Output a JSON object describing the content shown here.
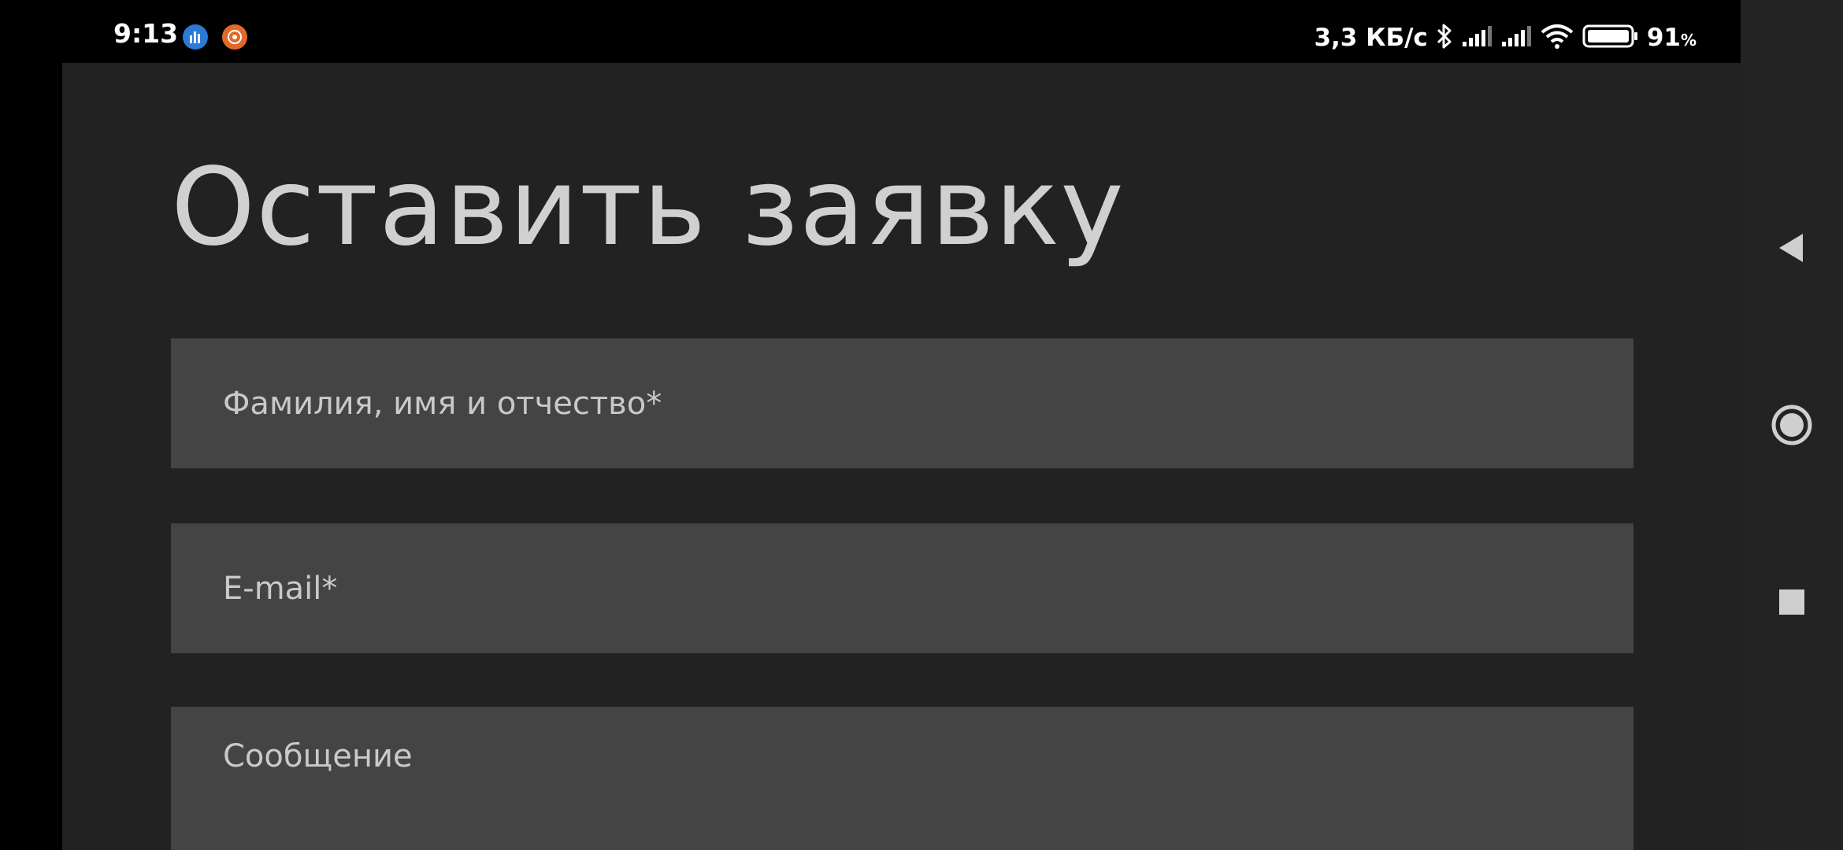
{
  "status_bar": {
    "time": "9:13",
    "net_speed": "3,3 КБ/с",
    "battery_percent": "91",
    "battery_unit": "%",
    "icons": [
      "notification-app-1-icon",
      "notification-app-2-icon",
      "bluetooth-icon",
      "signal-1-icon",
      "signal-2-icon",
      "wifi-icon",
      "battery-icon"
    ]
  },
  "form": {
    "title": "Оставить заявку",
    "name_placeholder": "Фамилия, имя и отчество*",
    "email_placeholder": "E-mail*",
    "message_placeholder": "Сообщение"
  },
  "nav_bar": {
    "buttons": [
      "back",
      "home",
      "recents"
    ]
  },
  "colors": {
    "page_background": "#222222",
    "field_background": "#444444",
    "title_text": "#d0d0d0",
    "placeholder_text": "#c9c9c9",
    "nav_background": "#232323"
  }
}
